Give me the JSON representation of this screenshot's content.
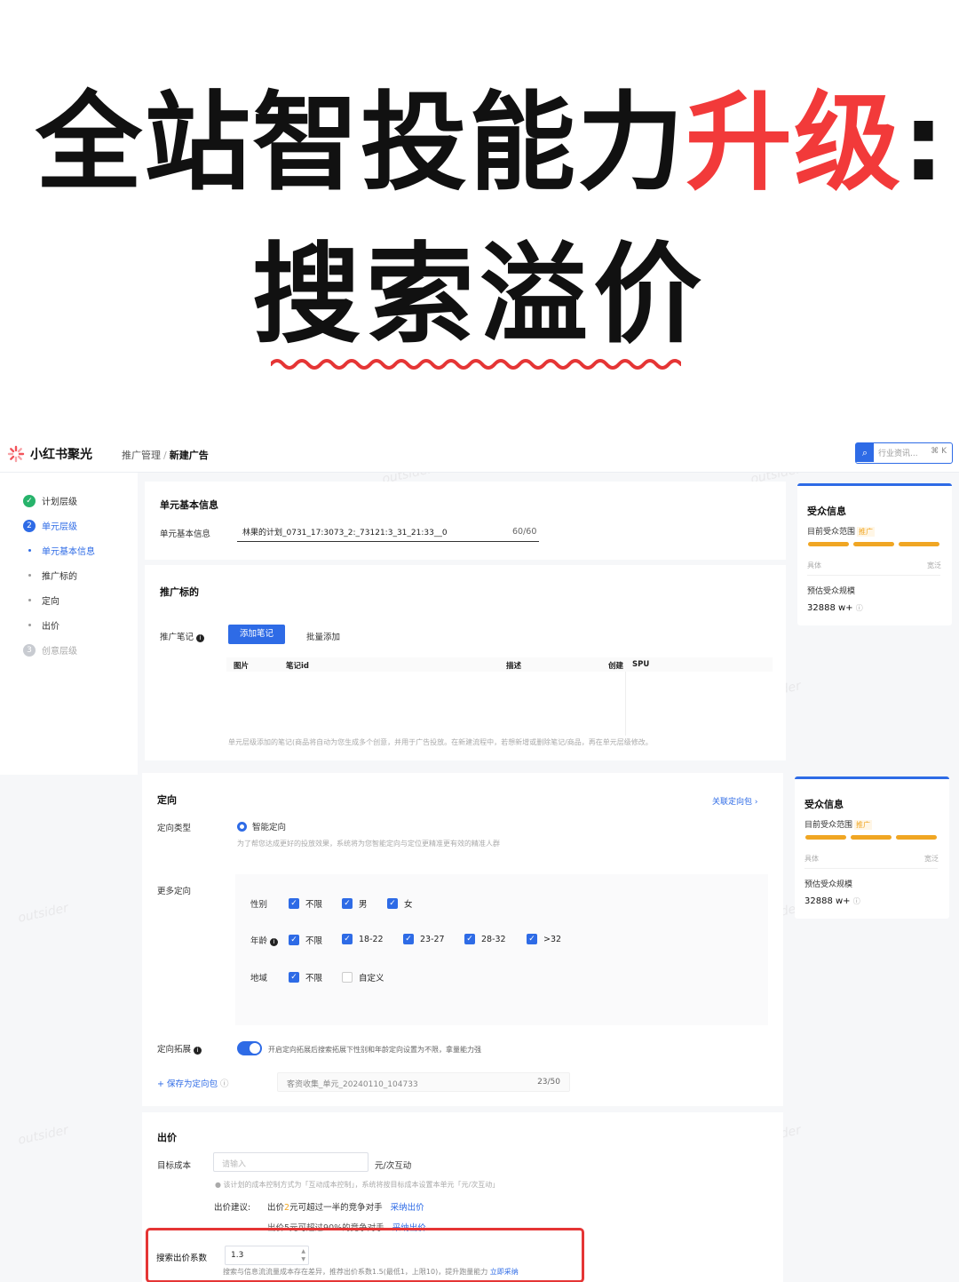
{
  "hero": {
    "title_part1": "全站智投能力",
    "title_accent": "升级",
    "title_colon": ":",
    "subtitle": "搜索溢价"
  },
  "colors": {
    "accent_red": "#f23a3a",
    "primary_blue": "#2e6be6",
    "warning_orange": "#f0a623"
  },
  "header": {
    "brand": "小红书聚光",
    "breadcrumb_parent": "推广管理",
    "breadcrumb_sep": "/",
    "breadcrumb_current": "新建广告",
    "search_placeholder": "行业资讯...",
    "search_shortcut": "⌘ K"
  },
  "steps": [
    {
      "label": "计划层级",
      "state": "done"
    },
    {
      "label": "单元层级",
      "state": "active",
      "num": "2"
    },
    {
      "label": "单元基本信息",
      "state": "sub-active"
    },
    {
      "label": "推广标的",
      "state": "sub"
    },
    {
      "label": "定向",
      "state": "sub"
    },
    {
      "label": "出价",
      "state": "sub"
    },
    {
      "label": "创意层级",
      "state": "muted",
      "num": "3"
    }
  ],
  "unit_info": {
    "heading": "单元基本信息",
    "name_label": "单元基本信息",
    "name_value": "林果的计划_0731_17:3073_2:_73121:3_31_21:33__0",
    "name_count": "60/60"
  },
  "promo_target": {
    "heading": "推广标的",
    "note_label": "推广笔记",
    "add_note_button": "添加笔记",
    "batch_add": "批量添加",
    "columns": [
      "图片",
      "笔记id",
      "描述",
      "创建",
      "SPU"
    ],
    "hint": "单元层级添加的笔记(商品将自动为您生成多个创意，并用于广告投放。在新建流程中，若想新增或删除笔记/商品，再在单元层级修改。"
  },
  "targeting": {
    "heading": "定向",
    "link": "关联定向包",
    "type_label": "定向类型",
    "type_option": "智能定向",
    "type_hint": "为了帮您达成更好的投放效果，系统将为您智能定向与定位更精准更有效的精准人群",
    "more_label": "更多定向",
    "gender_label": "性别",
    "gender_options": [
      "不限",
      "男",
      "女"
    ],
    "age_label": "年龄",
    "age_options": [
      "不限",
      "18-22",
      "23-27",
      "28-32",
      ">32"
    ],
    "region_label": "地域",
    "region_options": [
      "不限",
      "自定义"
    ],
    "expand_label": "定向拓展",
    "expand_hint": "开启定向拓展后搜索拓展下性别和年龄定向设置为不限，拿量能力强",
    "save_pkg": "+ 保存为定向包",
    "pkg_name": "客资收集_单元_20240110_104733",
    "pkg_count": "23/50"
  },
  "bid": {
    "heading": "出价",
    "target_cost_label": "目标成本",
    "target_cost_placeholder": "请输入",
    "unit": "元/次互动",
    "cost_hint": "该计划的成本控制方式为「互动成本控制」，系统将按目标成本设置本单元「元/次互动」",
    "suggest_label": "出价建议:",
    "suggest_1_prefix": "出价",
    "suggest_1_num": "2",
    "suggest_1_suffix": "元可超过一半的竞争对手",
    "suggest_1_link": "采纳出价",
    "suggest_2": "出价5元可超过90%的竞争对手",
    "suggest_2_link": "采纳出价",
    "search_coef_label": "搜索出价系数",
    "search_coef_value": "1.3",
    "search_coef_hint": "搜索与信息流流量成本存在差异，推荐出价系数1.5(最低1，上限10)，提升跑量能力",
    "search_coef_link": "立即采纳"
  },
  "audience": {
    "heading": "受众信息",
    "range_label": "目前受众范围",
    "range_tag": "推广",
    "narrow": "具体",
    "wide": "宽泛",
    "estimate_label": "预估受众规模",
    "estimate_value": "32888 w+"
  },
  "watermark_text": "outsider"
}
